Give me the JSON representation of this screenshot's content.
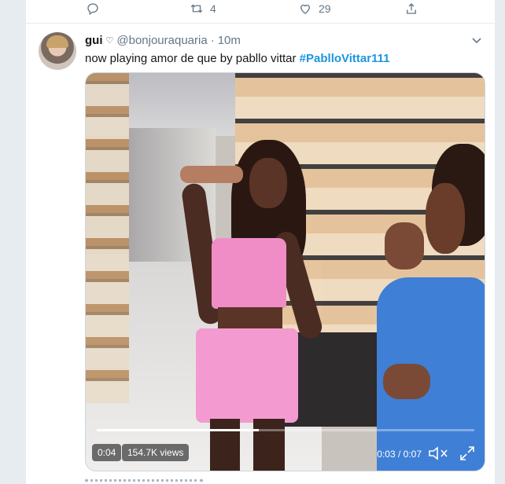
{
  "prev_tweet_actions": {
    "reply_icon": "reply-icon",
    "retweet_count": "4",
    "like_count": "29",
    "share_icon": "share-icon"
  },
  "tweet": {
    "display_name": "gui",
    "badge_icon": "heart-outline-icon",
    "handle": "@bonjouraquaria",
    "separator": "·",
    "time": "10m",
    "text": "now playing amor de que by pabllo vittar ",
    "hashtag": "#PablloVittar111",
    "menu_icon": "chevron-down-icon"
  },
  "video": {
    "current_time": "0:04",
    "views": "154.7K views",
    "timestamp": "0:03 / 0:07",
    "progress_fraction": 0.43,
    "mute_icon": "volume-muted-icon",
    "fullscreen_icon": "fullscreen-icon"
  },
  "colors": {
    "link": "#1b95e0",
    "secondary_text": "#657786",
    "background": "#e6ecf0"
  }
}
